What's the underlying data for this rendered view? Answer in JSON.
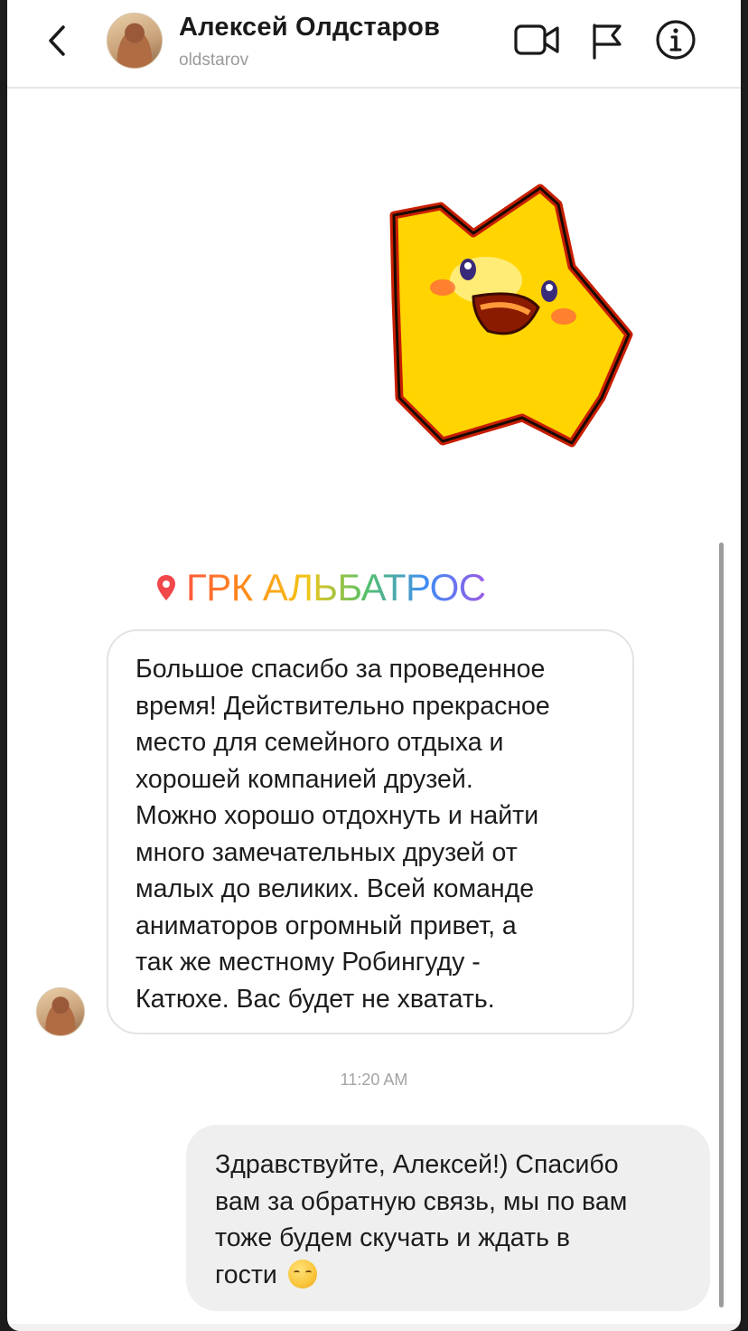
{
  "header": {
    "contact_name": "Алексей Олдстаров",
    "username": "oldstarov",
    "icons": {
      "back": "chevron-left-icon",
      "video": "video-camera-icon",
      "report": "flag-icon",
      "info": "info-icon"
    }
  },
  "conversation": {
    "location_tag": "ГРК АЛЬБАТРОС",
    "incoming_message": {
      "lines": [
        "Большое спасибо за проведенное",
        "время! Действительно прекрасное",
        "место для семейного отдыха и",
        "хорошей компанией друзей.",
        "Можно хорошо отдохнуть и найти",
        "много замечательных друзей от",
        "малых до великих. Всей команде",
        "аниматоров огромный привет, а",
        "так же местному Робингуду -",
        "Катюхе. Вас будет не хватать."
      ]
    },
    "timestamp": "11:20 AM",
    "outgoing_message": {
      "lines": [
        "Здравствуйте, Алексей!) Спасибо",
        "вам за обратную связь, мы по вам",
        "тоже будем скучать и ждать в",
        "гости"
      ],
      "emoji": "☺️"
    }
  },
  "colors": {
    "pin": "#f0474a",
    "bubble_out_bg": "#efefef",
    "bubble_in_border": "#e3e3e3",
    "sticker_yellow": "#ffd400"
  }
}
